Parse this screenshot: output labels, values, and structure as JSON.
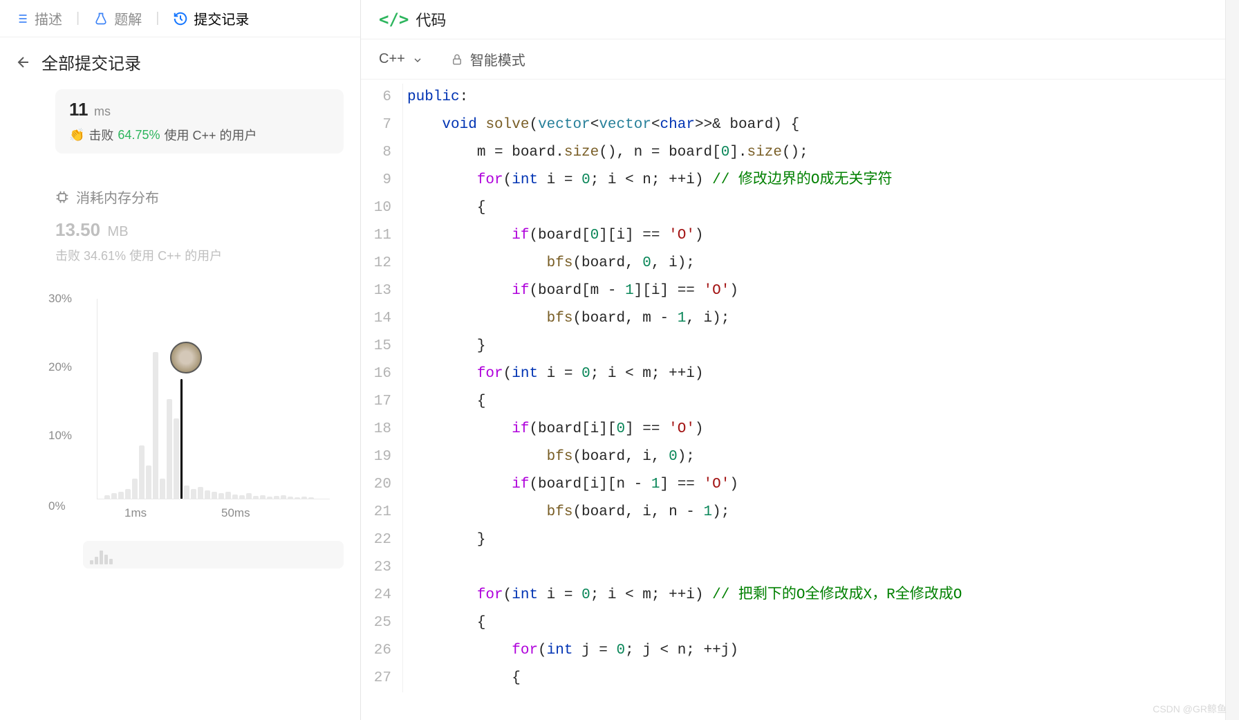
{
  "tabs": {
    "description": "描述",
    "solution": "题解",
    "submissions": "提交记录"
  },
  "subheader": "全部提交记录",
  "runtime": {
    "value": "11",
    "unit": "ms",
    "beat_label": "击败",
    "beat_pct": "64.75%",
    "beat_suffix": "使用 C++ 的用户"
  },
  "memory": {
    "header": "消耗内存分布",
    "value": "13.50",
    "unit": "MB",
    "beat_label": "击败",
    "beat_pct": "34.61%",
    "beat_suffix": "使用 C++ 的用户"
  },
  "chart_data": {
    "type": "bar",
    "title": "",
    "xlabel": "",
    "ylabel": "",
    "ylim": [
      0,
      30
    ],
    "y_ticks": [
      "30%",
      "20%",
      "10%",
      "0%"
    ],
    "x_ticks": [
      "1ms",
      "50ms"
    ],
    "marker_position": 11,
    "series": [
      {
        "name": "distribution",
        "values": [
          0.5,
          0.8,
          1,
          1.5,
          3,
          8,
          5,
          22,
          3,
          15,
          12,
          2,
          1.5,
          1.8,
          1.2,
          1,
          0.8,
          1,
          0.6,
          0.5,
          0.8,
          0.4,
          0.5,
          0.3,
          0.4,
          0.5,
          0.3,
          0.2,
          0.3,
          0.2
        ]
      }
    ]
  },
  "code": {
    "header": "代码",
    "language": "C++",
    "mode": "智能模式",
    "start_line": 6,
    "lines": [
      {
        "n": 6,
        "tokens": [
          {
            "t": "public",
            "c": "kw"
          },
          {
            "t": ":",
            "c": ""
          }
        ]
      },
      {
        "n": 7,
        "tokens": [
          {
            "t": "    ",
            "c": ""
          },
          {
            "t": "void",
            "c": "kw"
          },
          {
            "t": " ",
            "c": ""
          },
          {
            "t": "solve",
            "c": "fn"
          },
          {
            "t": "(",
            "c": ""
          },
          {
            "t": "vector",
            "c": "typ"
          },
          {
            "t": "<",
            "c": ""
          },
          {
            "t": "vector",
            "c": "typ"
          },
          {
            "t": "<",
            "c": ""
          },
          {
            "t": "char",
            "c": "kw"
          },
          {
            "t": ">>& board) {",
            "c": ""
          }
        ]
      },
      {
        "n": 8,
        "tokens": [
          {
            "t": "        m = board.",
            "c": ""
          },
          {
            "t": "size",
            "c": "fn"
          },
          {
            "t": "(), n = board[",
            "c": ""
          },
          {
            "t": "0",
            "c": "num"
          },
          {
            "t": "].",
            "c": ""
          },
          {
            "t": "size",
            "c": "fn"
          },
          {
            "t": "();",
            "c": ""
          }
        ]
      },
      {
        "n": 9,
        "tokens": [
          {
            "t": "        ",
            "c": ""
          },
          {
            "t": "for",
            "c": "kw-ctrl"
          },
          {
            "t": "(",
            "c": ""
          },
          {
            "t": "int",
            "c": "kw"
          },
          {
            "t": " i = ",
            "c": ""
          },
          {
            "t": "0",
            "c": "num"
          },
          {
            "t": "; i < n; ++i) ",
            "c": ""
          },
          {
            "t": "// 修改边界的O成无关字符",
            "c": "cmt"
          }
        ]
      },
      {
        "n": 10,
        "tokens": [
          {
            "t": "        {",
            "c": ""
          }
        ]
      },
      {
        "n": 11,
        "tokens": [
          {
            "t": "            ",
            "c": ""
          },
          {
            "t": "if",
            "c": "kw-ctrl"
          },
          {
            "t": "(board[",
            "c": ""
          },
          {
            "t": "0",
            "c": "num"
          },
          {
            "t": "][i] == ",
            "c": ""
          },
          {
            "t": "'O'",
            "c": "str"
          },
          {
            "t": ")",
            "c": ""
          }
        ]
      },
      {
        "n": 12,
        "tokens": [
          {
            "t": "                ",
            "c": ""
          },
          {
            "t": "bfs",
            "c": "fn"
          },
          {
            "t": "(board, ",
            "c": ""
          },
          {
            "t": "0",
            "c": "num"
          },
          {
            "t": ", i);",
            "c": ""
          }
        ]
      },
      {
        "n": 13,
        "tokens": [
          {
            "t": "            ",
            "c": ""
          },
          {
            "t": "if",
            "c": "kw-ctrl"
          },
          {
            "t": "(board[m - ",
            "c": ""
          },
          {
            "t": "1",
            "c": "num"
          },
          {
            "t": "][i] == ",
            "c": ""
          },
          {
            "t": "'O'",
            "c": "str"
          },
          {
            "t": ")",
            "c": ""
          }
        ]
      },
      {
        "n": 14,
        "tokens": [
          {
            "t": "                ",
            "c": ""
          },
          {
            "t": "bfs",
            "c": "fn"
          },
          {
            "t": "(board, m - ",
            "c": ""
          },
          {
            "t": "1",
            "c": "num"
          },
          {
            "t": ", i);",
            "c": ""
          }
        ]
      },
      {
        "n": 15,
        "tokens": [
          {
            "t": "        }",
            "c": ""
          }
        ]
      },
      {
        "n": 16,
        "tokens": [
          {
            "t": "        ",
            "c": ""
          },
          {
            "t": "for",
            "c": "kw-ctrl"
          },
          {
            "t": "(",
            "c": ""
          },
          {
            "t": "int",
            "c": "kw"
          },
          {
            "t": " i = ",
            "c": ""
          },
          {
            "t": "0",
            "c": "num"
          },
          {
            "t": "; i < m; ++i)",
            "c": ""
          }
        ]
      },
      {
        "n": 17,
        "tokens": [
          {
            "t": "        {",
            "c": ""
          }
        ]
      },
      {
        "n": 18,
        "tokens": [
          {
            "t": "            ",
            "c": ""
          },
          {
            "t": "if",
            "c": "kw-ctrl"
          },
          {
            "t": "(board[i][",
            "c": ""
          },
          {
            "t": "0",
            "c": "num"
          },
          {
            "t": "] == ",
            "c": ""
          },
          {
            "t": "'O'",
            "c": "str"
          },
          {
            "t": ")",
            "c": ""
          }
        ]
      },
      {
        "n": 19,
        "tokens": [
          {
            "t": "                ",
            "c": ""
          },
          {
            "t": "bfs",
            "c": "fn"
          },
          {
            "t": "(board, i, ",
            "c": ""
          },
          {
            "t": "0",
            "c": "num"
          },
          {
            "t": ");",
            "c": ""
          }
        ]
      },
      {
        "n": 20,
        "tokens": [
          {
            "t": "            ",
            "c": ""
          },
          {
            "t": "if",
            "c": "kw-ctrl"
          },
          {
            "t": "(board[i][n - ",
            "c": ""
          },
          {
            "t": "1",
            "c": "num"
          },
          {
            "t": "] == ",
            "c": ""
          },
          {
            "t": "'O'",
            "c": "str"
          },
          {
            "t": ")",
            "c": ""
          }
        ]
      },
      {
        "n": 21,
        "tokens": [
          {
            "t": "                ",
            "c": ""
          },
          {
            "t": "bfs",
            "c": "fn"
          },
          {
            "t": "(board, i, n - ",
            "c": ""
          },
          {
            "t": "1",
            "c": "num"
          },
          {
            "t": ");",
            "c": ""
          }
        ]
      },
      {
        "n": 22,
        "tokens": [
          {
            "t": "        }",
            "c": ""
          }
        ]
      },
      {
        "n": 23,
        "tokens": [
          {
            "t": "",
            "c": ""
          }
        ]
      },
      {
        "n": 24,
        "tokens": [
          {
            "t": "        ",
            "c": ""
          },
          {
            "t": "for",
            "c": "kw-ctrl"
          },
          {
            "t": "(",
            "c": ""
          },
          {
            "t": "int",
            "c": "kw"
          },
          {
            "t": " i = ",
            "c": ""
          },
          {
            "t": "0",
            "c": "num"
          },
          {
            "t": "; i < m; ++i) ",
            "c": ""
          },
          {
            "t": "// 把剩下的O全修改成X，R全修改成O",
            "c": "cmt"
          }
        ]
      },
      {
        "n": 25,
        "tokens": [
          {
            "t": "        {",
            "c": ""
          }
        ]
      },
      {
        "n": 26,
        "tokens": [
          {
            "t": "            ",
            "c": ""
          },
          {
            "t": "for",
            "c": "kw-ctrl"
          },
          {
            "t": "(",
            "c": ""
          },
          {
            "t": "int",
            "c": "kw"
          },
          {
            "t": " j = ",
            "c": ""
          },
          {
            "t": "0",
            "c": "num"
          },
          {
            "t": "; j < n; ++j)",
            "c": ""
          }
        ]
      },
      {
        "n": 27,
        "tokens": [
          {
            "t": "            {",
            "c": ""
          }
        ]
      }
    ]
  },
  "watermark": "CSDN @GR鲸鱼"
}
